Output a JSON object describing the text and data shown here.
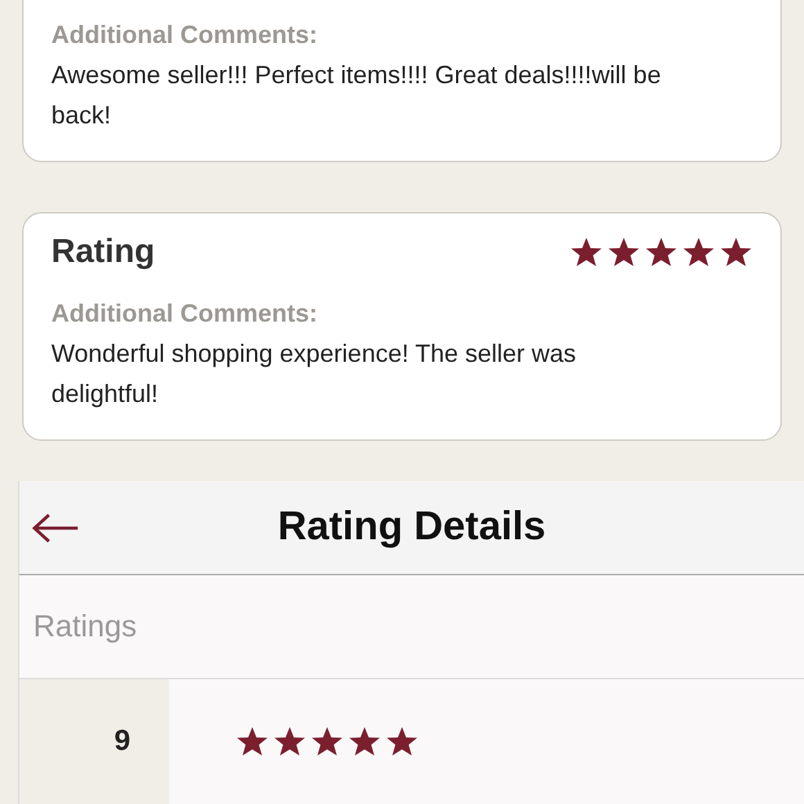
{
  "reviews": [
    {
      "comments_label": "Additional Comments:",
      "comment": "Awesome seller!!! Perfect items!!!! Great deals!!!!will be back!"
    },
    {
      "title": "Rating",
      "stars": 5,
      "comments_label": "Additional Comments:",
      "comment": "Wonderful shopping experience! The seller was delightful!"
    }
  ],
  "detail": {
    "title": "Rating Details",
    "section": "Ratings",
    "rows": [
      {
        "count": "9",
        "stars": 5
      }
    ]
  }
}
